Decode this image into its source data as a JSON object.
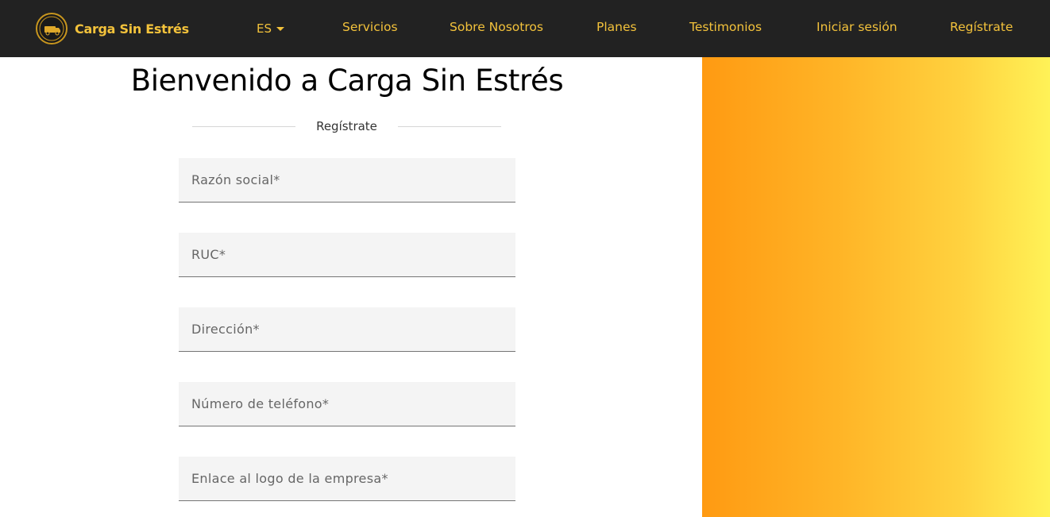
{
  "navbar": {
    "brand_name": "Carga Sin Estrés",
    "language": "ES",
    "links": [
      "Servicios",
      "Sobre Nosotros",
      "Planes",
      "Testimonios",
      "Iniciar sesión",
      "Regístrate"
    ]
  },
  "main": {
    "title": "Bienvenido a Carga Sin Estrés",
    "section_label": "Regístrate",
    "fields": [
      {
        "placeholder": "Razón social*",
        "value": ""
      },
      {
        "placeholder": "RUC*",
        "value": ""
      },
      {
        "placeholder": "Dirección*",
        "value": ""
      },
      {
        "placeholder": "Número de teléfono*",
        "value": ""
      },
      {
        "placeholder": "Enlace al logo de la empresa*",
        "value": ""
      }
    ]
  },
  "colors": {
    "navbar_bg": "#222222",
    "accent": "#f3c23b",
    "gradient_start": "#ff9a12",
    "gradient_end": "#fff257",
    "field_bg": "#f4f4f4"
  },
  "icons": {
    "brand_logo": "truck-badge-icon",
    "language_caret": "caret-down-icon"
  }
}
